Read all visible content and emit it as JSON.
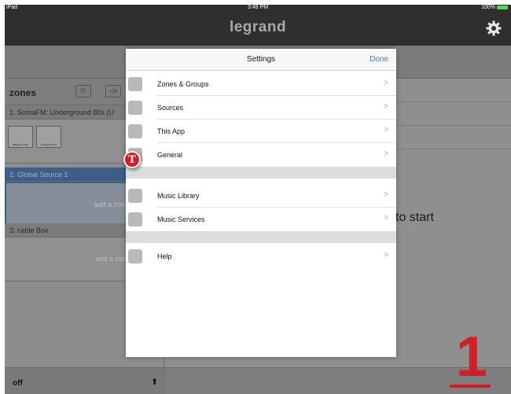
{
  "status": {
    "carrier": "iPad",
    "time": "3:48 PM",
    "battery": "100%"
  },
  "app": {
    "brand": "legrand"
  },
  "sidebar": {
    "title": "zones",
    "sources": [
      {
        "label": "1. SomaFM: Underground 80s (U",
        "zones": [
          "family room",
          "living room"
        ]
      },
      {
        "label": "2. Global Source 1",
        "hint": "add a zone to start"
      },
      {
        "label": "3. cable Box",
        "hint": "add a zone to start"
      }
    ],
    "footer": {
      "label": "off"
    }
  },
  "main": {
    "hint": "to start"
  },
  "settings": {
    "title": "Settings",
    "done": "Done",
    "items": [
      {
        "label": "Zones & Groups",
        "icon": "house-icon"
      },
      {
        "label": "Sources",
        "icon": "sources-icon"
      },
      {
        "label": "This App",
        "icon": "device-icon"
      },
      {
        "label": "General",
        "icon": "general-icon"
      },
      {
        "label": "Music Library",
        "icon": "music-note-icon"
      },
      {
        "label": "Music Services",
        "icon": "cloud-icon"
      },
      {
        "label": "Help",
        "icon": "help-icon"
      }
    ]
  },
  "annotation": {
    "marker": "T",
    "step": "1"
  },
  "colors": {
    "accent": "#3f7fc4",
    "marker": "#d01f2b",
    "selected_source": "#3d5f87"
  }
}
